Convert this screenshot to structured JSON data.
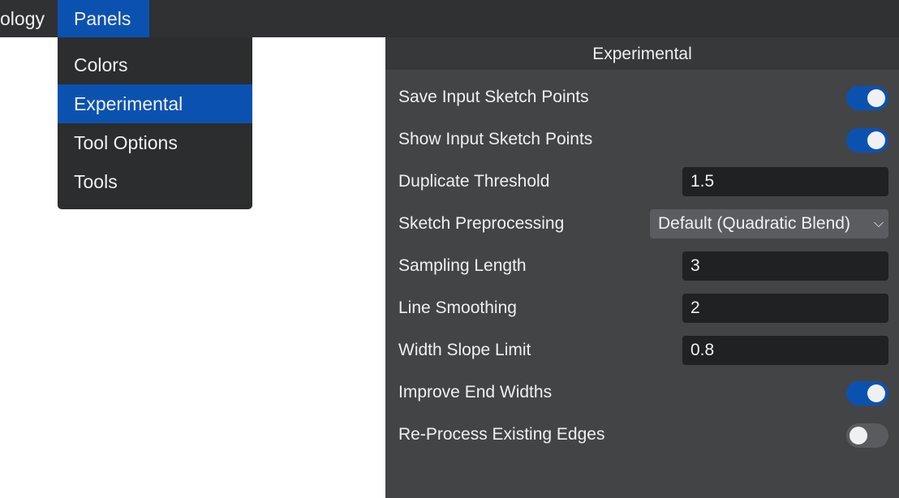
{
  "menubar": {
    "items": [
      {
        "label": "ology"
      },
      {
        "label": "Panels",
        "active": true
      }
    ]
  },
  "panels_menu": {
    "items": [
      {
        "label": "Colors"
      },
      {
        "label": "Experimental",
        "selected": true
      },
      {
        "label": "Tool Options"
      },
      {
        "label": "Tools"
      }
    ]
  },
  "panel": {
    "title": "Experimental",
    "rows": [
      {
        "label": "Save Input Sketch Points",
        "type": "toggle",
        "value": true
      },
      {
        "label": "Show Input Sketch Points",
        "type": "toggle",
        "value": true
      },
      {
        "label": "Duplicate Threshold",
        "type": "number",
        "value": "1.5"
      },
      {
        "label": "Sketch Preprocessing",
        "type": "select",
        "value": "Default (Quadratic Blend)"
      },
      {
        "label": "Sampling Length",
        "type": "number",
        "value": "3"
      },
      {
        "label": "Line Smoothing",
        "type": "number",
        "value": "2"
      },
      {
        "label": "Width Slope Limit",
        "type": "number",
        "value": "0.8"
      },
      {
        "label": "Improve End Widths",
        "type": "toggle",
        "value": true
      },
      {
        "label": "Re-Process Existing Edges",
        "type": "toggle",
        "value": false
      }
    ]
  },
  "colors": {
    "accent": "#0b52b0",
    "panel_bg": "#434446",
    "menubar_bg": "#303133"
  }
}
